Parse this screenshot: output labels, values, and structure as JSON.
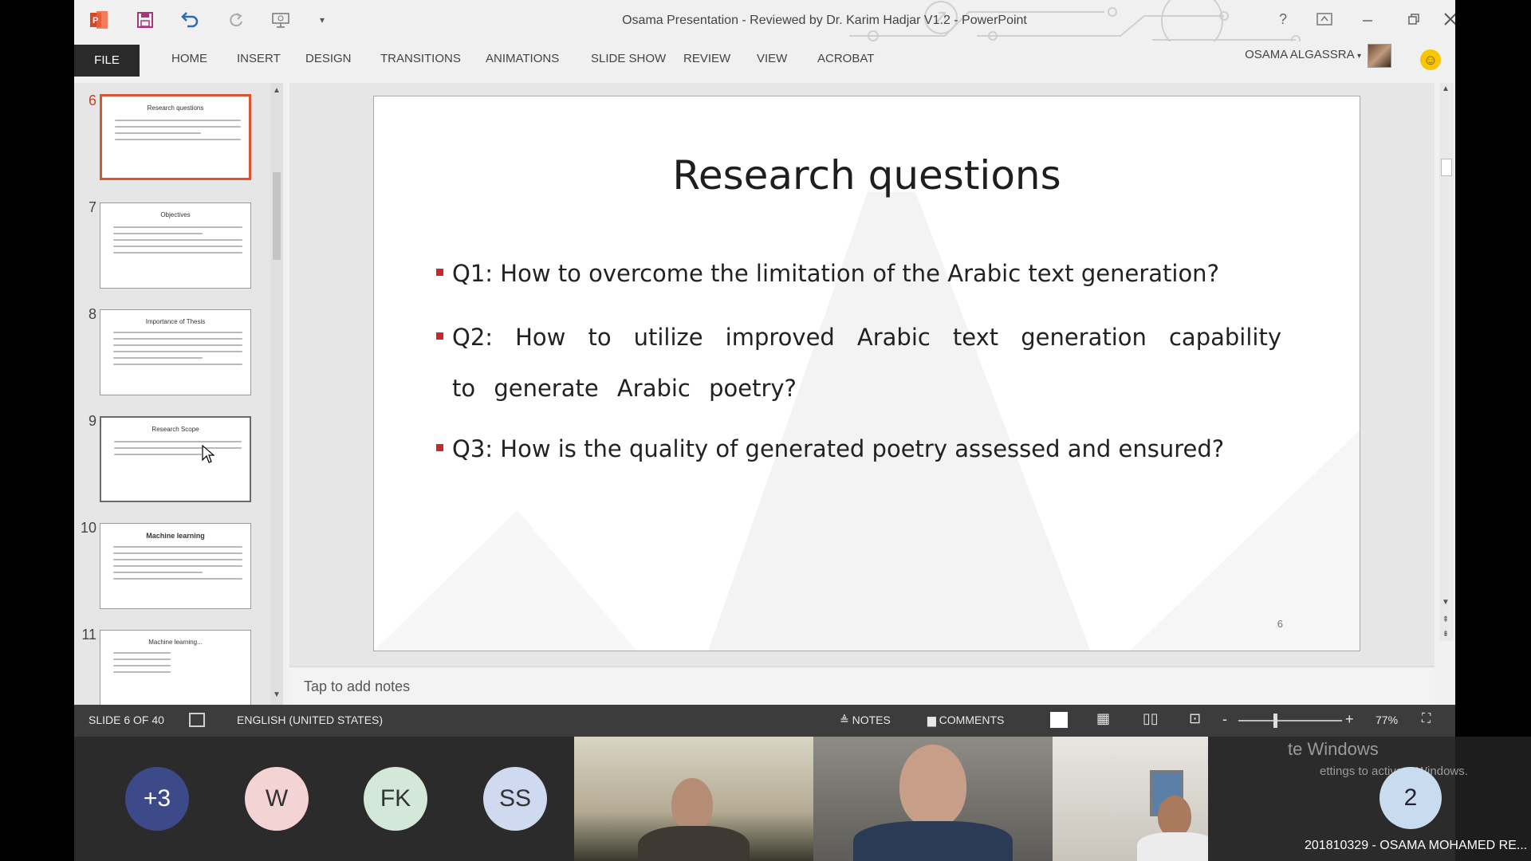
{
  "app": {
    "title": "Osama Presentation - Reviewed by Dr. Karim Hadjar V1.2 - PowerPoint",
    "user_name": "OSAMA ALGASSRA"
  },
  "ribbon": {
    "tabs": [
      "FILE",
      "HOME",
      "INSERT",
      "DESIGN",
      "TRANSITIONS",
      "ANIMATIONS",
      "SLIDE SHOW",
      "REVIEW",
      "VIEW",
      "ACROBAT"
    ]
  },
  "thumbnails": [
    {
      "num": "6",
      "title": "Research questions",
      "selected": true
    },
    {
      "num": "7",
      "title": "Objectives",
      "selected": false
    },
    {
      "num": "8",
      "title": "Importance of Thesis",
      "selected": false
    },
    {
      "num": "9",
      "title": "Research Scope",
      "selected": false
    },
    {
      "num": "10",
      "title": "Machine learning",
      "selected": false
    },
    {
      "num": "11",
      "title": "Machine learning...",
      "selected": false
    }
  ],
  "slide": {
    "title": "Research questions",
    "bullets": [
      "Q1: How to overcome the limitation of the Arabic text generation?",
      "Q2: How to utilize improved Arabic text generation capability to generate Arabic poetry?",
      "Q3: How is the quality of generated poetry assessed and ensured?"
    ],
    "number": "6"
  },
  "notes": {
    "placeholder": "Tap to add notes"
  },
  "status": {
    "slide_info": "SLIDE 6 OF 40",
    "language": "ENGLISH (UNITED STATES)",
    "notes_label": "NOTES",
    "comments_label": "COMMENTS",
    "zoom_minus": "-",
    "zoom_plus": "+",
    "zoom": "77%"
  },
  "meeting": {
    "participants": [
      {
        "label": "+3",
        "color": "#3d4a8a",
        "text_color": "#ffffff"
      },
      {
        "label": "W",
        "color": "#f4d3d5",
        "text_color": "#333333"
      },
      {
        "label": "FK",
        "color": "#d4e8d9",
        "text_color": "#333333"
      },
      {
        "label": "SS",
        "color": "#cfd9f0",
        "text_color": "#333333"
      }
    ],
    "extra_count": "2",
    "windows_notice": "te Windows",
    "windows_notice_sub": "ettings to activate Windows.",
    "presenter_id": "201810329 - OSAMA MOHAMED RE..."
  },
  "colors": {
    "accent": "#d24726",
    "bullet": "#c8292f",
    "statusbar": "#3c3c3c"
  }
}
